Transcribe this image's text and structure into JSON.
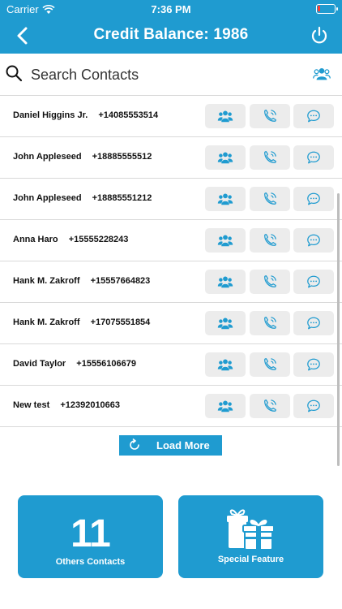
{
  "status_bar": {
    "carrier": "Carrier",
    "time": "7:36 PM",
    "battery_level": 0.15
  },
  "nav": {
    "title": "Credit Balance: 1986",
    "back_icon": "chevron-left-icon",
    "power_icon": "power-icon"
  },
  "search": {
    "placeholder": "Search Contacts",
    "value": "",
    "search_icon": "magnifier-icon",
    "group_icon": "group-icon"
  },
  "contacts": [
    {
      "name": "Daniel Higgins Jr.",
      "phone": "+14085553514"
    },
    {
      "name": "John Appleseed",
      "phone": "+18885555512"
    },
    {
      "name": "John Appleseed",
      "phone": "+18885551212"
    },
    {
      "name": "Anna Haro",
      "phone": "+15555228243"
    },
    {
      "name": "Hank M. Zakroff",
      "phone": "+15557664823"
    },
    {
      "name": "Hank M. Zakroff",
      "phone": "+17075551854"
    },
    {
      "name": "David Taylor",
      "phone": "+15556106679"
    },
    {
      "name": "New test",
      "phone": "+12392010663"
    }
  ],
  "row_actions": [
    "group-icon",
    "phone-call-icon",
    "chat-bubble-icon"
  ],
  "load_more": {
    "label": "Load More",
    "icon": "refresh-icon"
  },
  "cards": {
    "others": {
      "count": "11",
      "label": "Others Contacts"
    },
    "special": {
      "label": "Special Feature",
      "icon": "gift-icon"
    }
  },
  "colors": {
    "accent": "#1f9bd0",
    "button_bg": "#ececec",
    "icon": "#1f9bd0"
  }
}
